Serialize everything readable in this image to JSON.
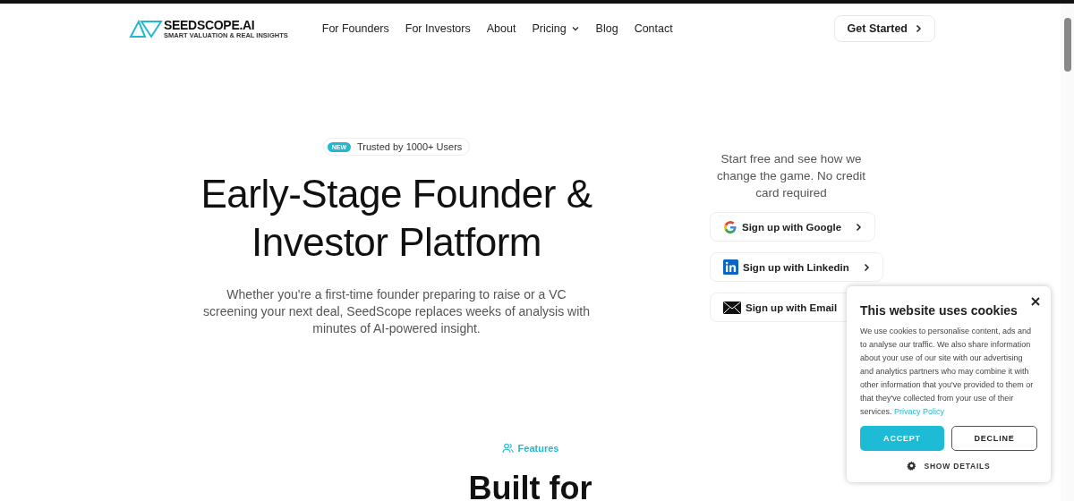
{
  "header": {
    "logo": {
      "name": "SEEDSCOPE.AI",
      "tagline": "SMART VALUATION & REAL INSIGHTS"
    },
    "nav": [
      {
        "label": "For Founders",
        "has_menu": false
      },
      {
        "label": "For Investors",
        "has_menu": false
      },
      {
        "label": "About",
        "has_menu": false
      },
      {
        "label": "Pricing",
        "has_menu": true
      },
      {
        "label": "Blog",
        "has_menu": false
      },
      {
        "label": "Contact",
        "has_menu": false
      }
    ],
    "cta": "Get Started"
  },
  "hero": {
    "badge": {
      "tag": "NEW",
      "text": "Trusted by 1000+ Users"
    },
    "title": "Early-Stage Founder & Investor Platform",
    "subtitle": "Whether you're a first-time founder preparing to raise or a VC screening your next deal, SeedScope replaces weeks of analysis with minutes of AI-powered insight."
  },
  "signup": {
    "intro": "Start free and see how we change the game. No credit card required",
    "buttons": [
      {
        "kind": "google",
        "label": "Sign up with Google",
        "chevron": true
      },
      {
        "kind": "linkedin",
        "label": "Sign up with Linkedin",
        "chevron": true
      },
      {
        "kind": "email",
        "label": "Sign up with Email",
        "chevron": false
      }
    ]
  },
  "features": {
    "eyebrow": "Features",
    "heading": "Built for"
  },
  "cookie_banner": {
    "title": "This website uses cookies",
    "body": "We use cookies to personalise content, ads and to analyse our traffic. We also share information about your use of our site with our advertising and analytics partners who may combine it with other information that you've provided to them or that they've collected from your use of their services.",
    "link": "Privacy Policy",
    "accept": "ACCEPT",
    "decline": "DECLINE",
    "details": "SHOW DETAILS"
  }
}
